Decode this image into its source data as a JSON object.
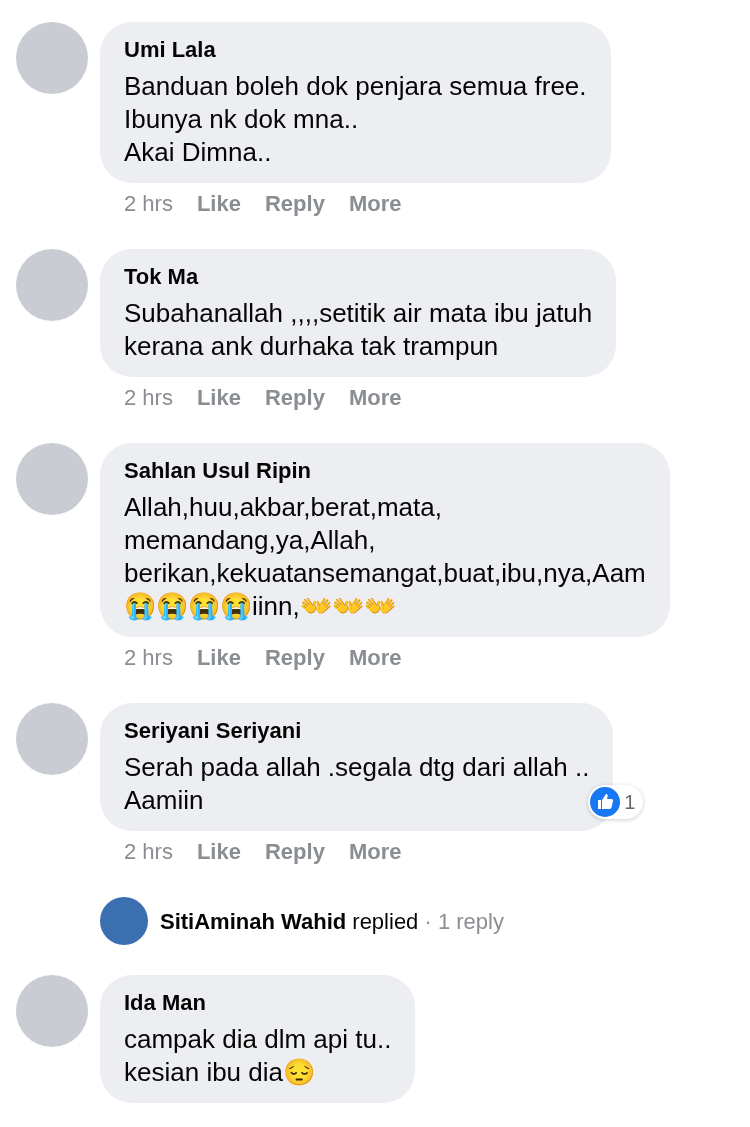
{
  "comments": [
    {
      "kind": "comment",
      "author": "Umi Lala",
      "text": "Banduan boleh dok penjara semua free.\nIbunya nk dok mna..\nAkai Dimna..",
      "actions": [
        "2 hrs",
        "Like",
        "Reply",
        "More"
      ]
    },
    {
      "kind": "comment",
      "author": "Tok Ma",
      "text": "Subahanallah ,,,,setitik air mata ibu jatuh\nkerana ank durhaka tak trampun",
      "actions": [
        "2 hrs",
        "Like",
        "Reply",
        "More"
      ]
    },
    {
      "kind": "comment",
      "author": "Sahlan Usul Ripin",
      "text": "Allah,huu,akbar,berat,mata,\nmemandang,ya,Allah,\nberikan,kekuatansemangat,buat,ibu,nya,Aam\n😭😭😭😭iinn,👐👐👐",
      "actions": [
        "2 hrs",
        "Like",
        "Reply",
        "More"
      ]
    },
    {
      "kind": "comment",
      "author": "Seriyani Seriyani",
      "text": "Serah pada allah .segala dtg dari allah ..\nAamiin",
      "reactions": "1",
      "actions": [
        "2 hrs",
        "Like",
        "Reply",
        "More"
      ]
    },
    {
      "kind": "reply_summary",
      "author": "SitiAminah Wahid",
      "verb": "replied",
      "count": "· 1 reply"
    },
    {
      "kind": "comment",
      "author": "Ida Man",
      "text": "campak dia dlm api tu..\nkesian ibu dia😔"
    }
  ]
}
